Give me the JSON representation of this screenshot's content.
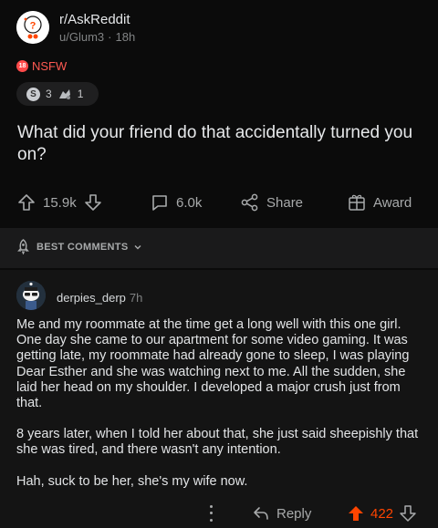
{
  "post": {
    "subreddit": "r/AskReddit",
    "author": "u/Glum3",
    "separator": "·",
    "age": "18h",
    "nsfw_label": "NSFW",
    "nsfw_badge": "18",
    "awards": [
      {
        "icon": "silver-award-icon",
        "glyph": "S",
        "count": "3"
      },
      {
        "icon": "helpful-award-icon",
        "count": "1"
      }
    ],
    "title": "What did your friend do that accidentally turned you on?",
    "actions": {
      "upvotes": "15.9k",
      "comments": "6.0k",
      "share_label": "Share",
      "award_label": "Award"
    }
  },
  "sort": {
    "label": "BEST COMMENTS"
  },
  "comment": {
    "author": "derpies_derp",
    "age": "7h",
    "paragraphs": [
      "Me and my roommate at the time get a long well with this one girl. One day she came to our apartment for some video gaming. It was getting late, my roommate had already gone to sleep, I was playing Dear Esther and she was watching next to me. All the sudden, she laid her head on my shoulder. I developed a major crush just from that.",
      "8 years later, when I told her about that, she just said sheepishly that she was tired, and there wasn't any intention.",
      "Hah, suck to be her, she's my wife now."
    ],
    "reply_label": "Reply",
    "score": "422"
  },
  "colors": {
    "background": "#0b0b0b",
    "band": "#1a1a1b",
    "comment_bg": "#141414",
    "upvote": "#ff4500",
    "nsfw": "#ff4a4a"
  }
}
